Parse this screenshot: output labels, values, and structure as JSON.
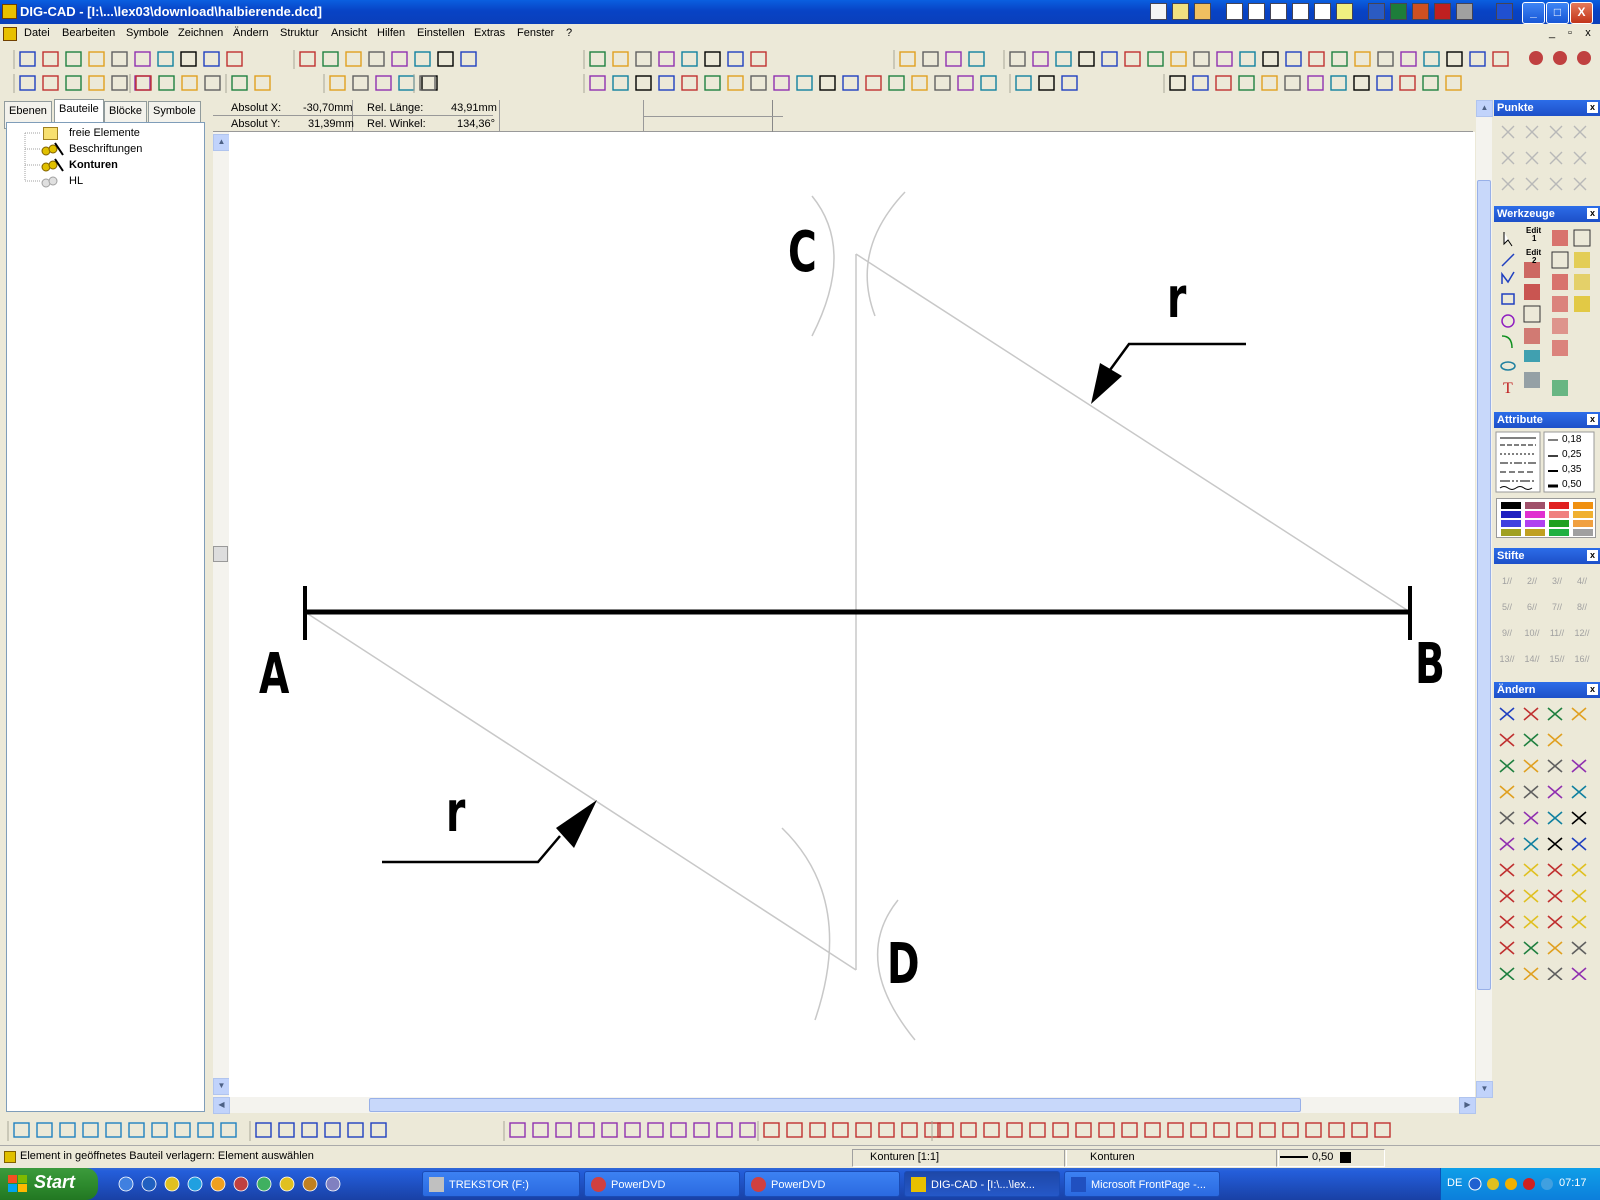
{
  "window": {
    "title": "DIG-CAD - [I:\\...\\lex03\\download\\halbierende.dcd]",
    "minimize": "_",
    "maximize": "□",
    "close": "X"
  },
  "menu": {
    "items": [
      "Datei",
      "Bearbeiten",
      "Symbole",
      "Zeichnen",
      "Ändern",
      "Struktur",
      "Ansicht",
      "Hilfen",
      "Einstellen",
      "Extras",
      "Fenster",
      "?"
    ],
    "mdi_min": "_",
    "mdi_restore": "▫",
    "mdi_close": "x"
  },
  "left_panel": {
    "tabs": [
      "Ebenen",
      "Bauteile",
      "Blöcke",
      "Symbole"
    ],
    "active_tab": "Bauteile",
    "tree": [
      {
        "label": "freie Elemente",
        "bold": false,
        "icon": "folder-icon"
      },
      {
        "label": "Beschriftungen",
        "bold": false,
        "icon": "component-icon"
      },
      {
        "label": "Konturen",
        "bold": true,
        "icon": "component-icon"
      },
      {
        "label": "HL",
        "bold": false,
        "icon": "component-grey-icon"
      }
    ]
  },
  "infobar": {
    "abs_x_label": "Absolut X:",
    "abs_x_value": "-30,70mm",
    "abs_y_label": "Absolut Y:",
    "abs_y_value": "31,39mm",
    "rel_len_label": "Rel. Länge:",
    "rel_len_value": "43,91mm",
    "rel_angle_label": "Rel. Winkel:",
    "rel_angle_value": "134,36°"
  },
  "drawing": {
    "point_a": "A",
    "point_b": "B",
    "point_c": "C",
    "point_d": "D",
    "radius_label_top": "r",
    "radius_label_bottom": "r"
  },
  "right_panels": {
    "punkte": "Punkte",
    "werkzeuge": "Werkzeuge",
    "attribute": "Attribute",
    "stifte": "Stifte",
    "aendern": "Ändern",
    "close_glyph": "x",
    "edit1": "Edit",
    "edit1_n": "1",
    "edit2": "Edit",
    "edit2_n": "2",
    "text_tool": "T",
    "line_widths": [
      "0,18",
      "0,25",
      "0,35",
      "0,50"
    ],
    "colors": [
      "#000000",
      "#A0506A",
      "#E02020",
      "#F09010",
      "#2020C0",
      "#E030D0",
      "#F08080",
      "#F0B030",
      "#4040E0",
      "#B040F0",
      "#20A020",
      "#F0A040",
      "#A0A020",
      "#C0A020",
      "#20B040",
      "#A0A0A0"
    ],
    "pens": [
      "1",
      "2",
      "3",
      "4",
      "5",
      "6",
      "7",
      "8",
      "9",
      "10",
      "11",
      "12",
      "13",
      "14",
      "15",
      "16"
    ]
  },
  "statusbar": {
    "message": "Element in geöffnetes Bauteil verlagern: Element auswählen",
    "component": "Konturen [1:1]",
    "layer": "Konturen",
    "linewidth": "0,50"
  },
  "taskbar": {
    "start": "Start",
    "tasks": [
      {
        "label": "TREKSTOR (F:)",
        "active": false
      },
      {
        "label": "PowerDVD",
        "active": false
      },
      {
        "label": "PowerDVD",
        "active": false
      },
      {
        "label": "DIG-CAD - [I:\\...\\lex...",
        "active": true
      },
      {
        "label": "Microsoft FrontPage -...",
        "active": false
      }
    ],
    "lang": "DE",
    "clock": "07:17"
  }
}
